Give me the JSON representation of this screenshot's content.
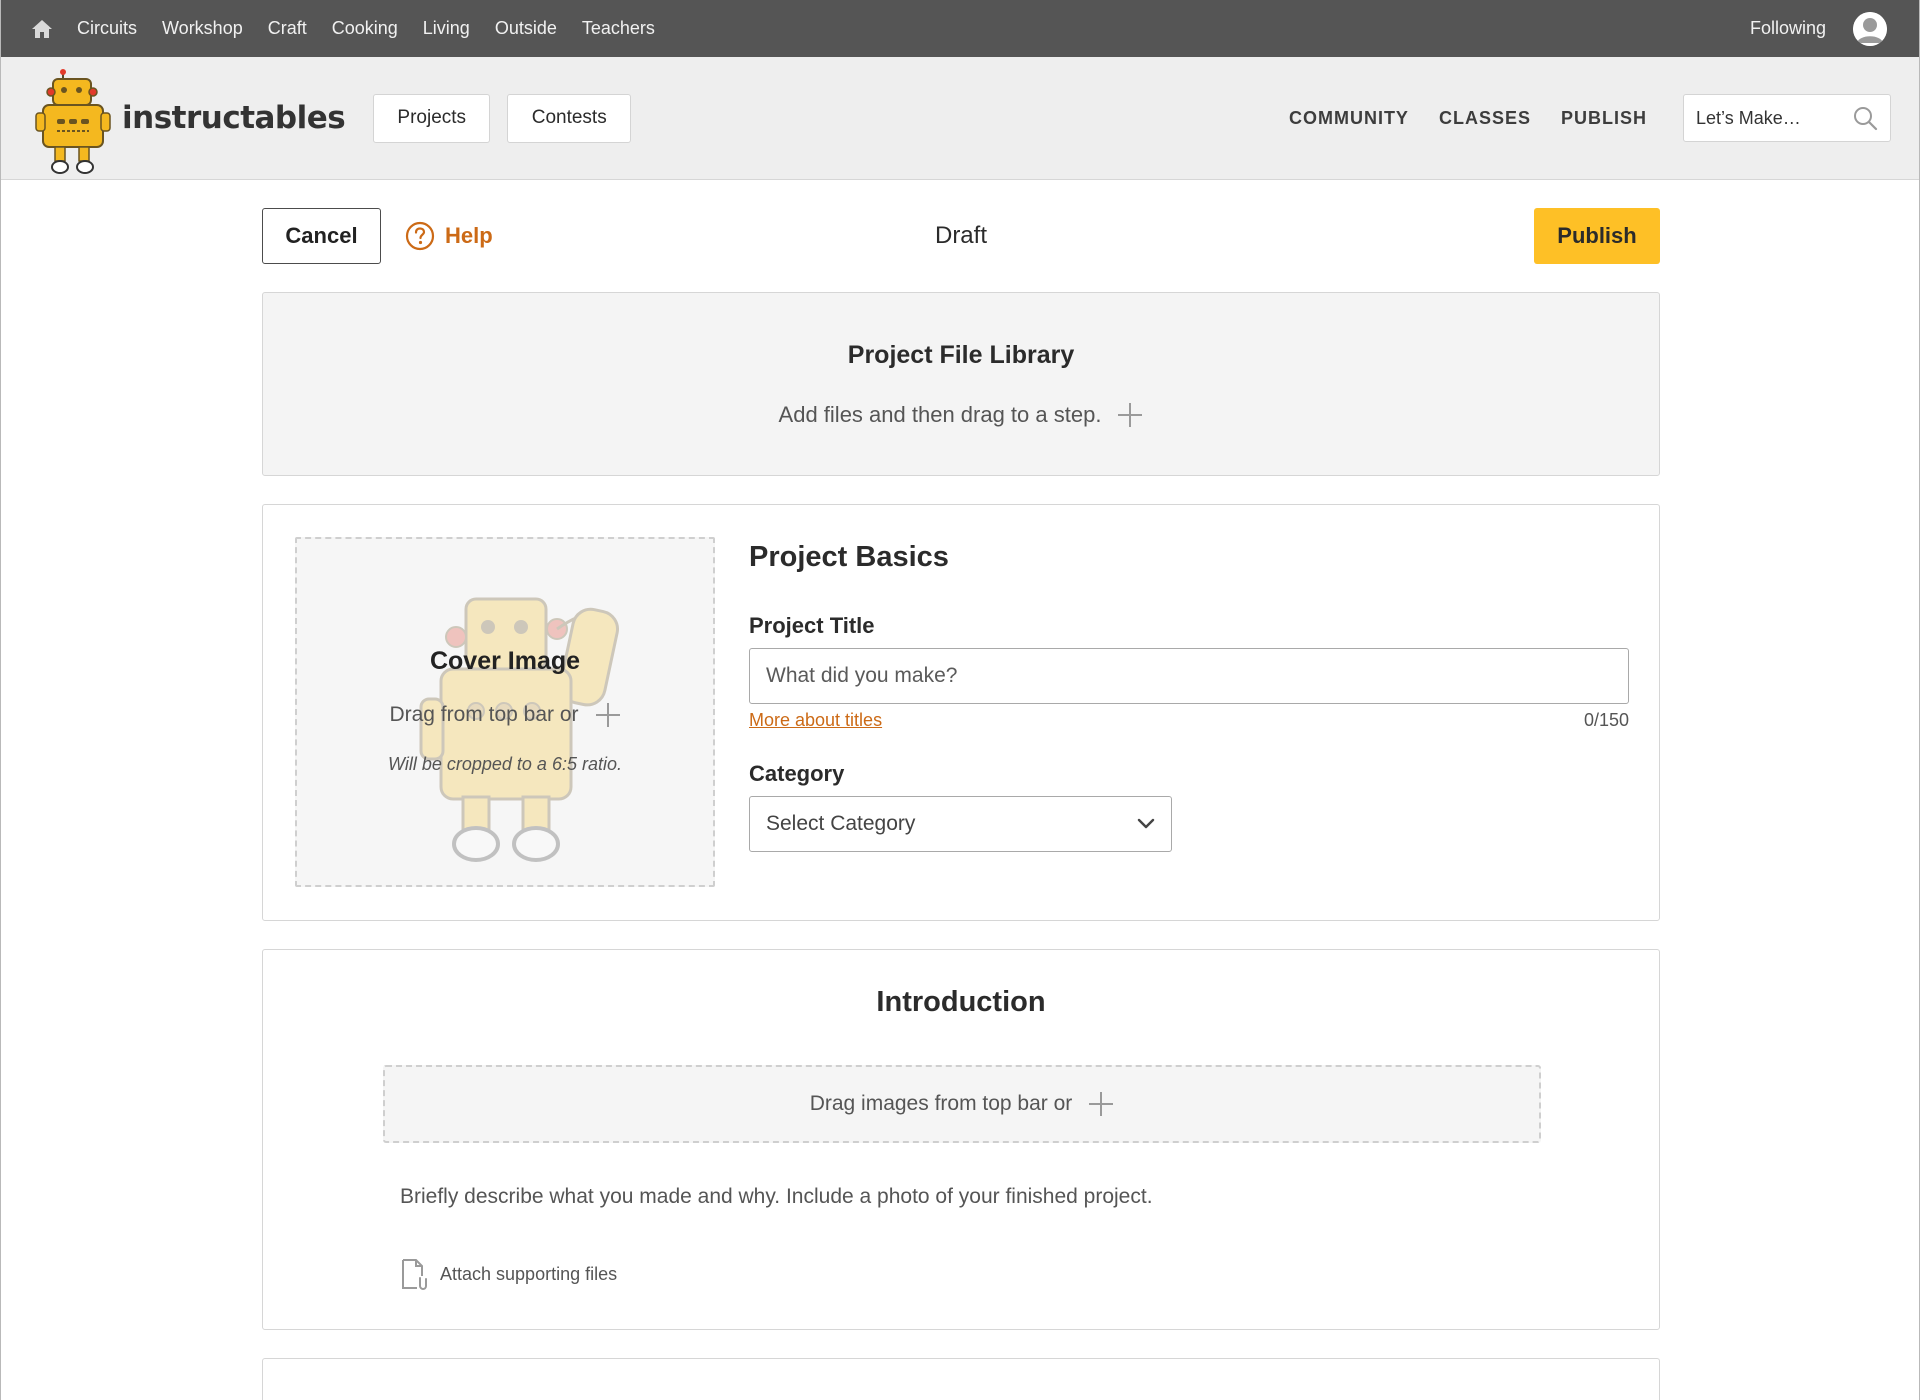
{
  "topbar": {
    "home_icon": "home-icon",
    "categories": [
      "Circuits",
      "Workshop",
      "Craft",
      "Cooking",
      "Living",
      "Outside",
      "Teachers"
    ],
    "following": "Following",
    "avatar_icon": "avatar-icon"
  },
  "header": {
    "logo_text": "instructables",
    "projects_button": "Projects",
    "contests_button": "Contests",
    "nav": [
      "COMMUNITY",
      "CLASSES",
      "PUBLISH"
    ],
    "search_placeholder": "Let’s Make…",
    "search_icon": "search-icon"
  },
  "editor": {
    "cancel_label": "Cancel",
    "help_label": "Help",
    "status": "Draft",
    "publish_label": "Publish"
  },
  "file_library": {
    "title": "Project File Library",
    "add_text": "Add files and then drag to a step."
  },
  "basics": {
    "cover_title": "Cover Image",
    "cover_drag": "Drag from top bar or",
    "cover_note": "Will be cropped to a 6:5 ratio.",
    "section_title": "Project Basics",
    "title_label": "Project Title",
    "title_placeholder": "What did you make?",
    "title_value": "",
    "more_titles_link": "More about titles",
    "char_count": "0/150",
    "category_label": "Category",
    "category_value": "Select Category"
  },
  "intro": {
    "title": "Introduction",
    "drop_text": "Drag images from top bar or",
    "description_placeholder": "Briefly describe what you made and why. Include a photo of your finished project.",
    "attach_label": "Attach supporting files"
  },
  "colors": {
    "topbar_bg": "#555555",
    "header_bg": "#eeeeee",
    "accent_orange": "#cc6a16",
    "publish_yellow": "#fec026"
  }
}
